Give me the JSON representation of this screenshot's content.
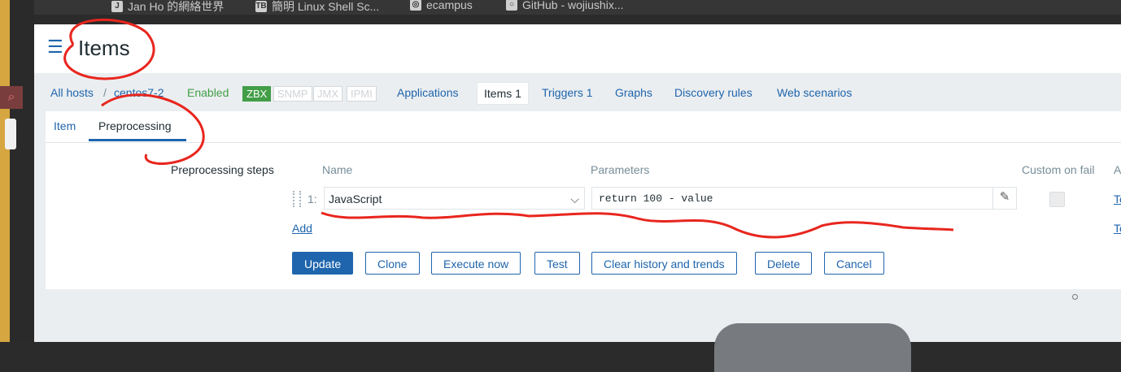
{
  "bookmarks": [
    {
      "icon": "J",
      "label": "Jan Ho 的網絡世界"
    },
    {
      "icon": "TB",
      "label": "簡明 Linux Shell Sc..."
    },
    {
      "icon": "◎",
      "label": "ecampus"
    },
    {
      "icon": "○",
      "label": "GitHub - wojiushix..."
    }
  ],
  "header": {
    "title": "Items"
  },
  "hostnav": {
    "all_hosts": "All hosts",
    "separator": "/",
    "host": "centos7-2",
    "status": "Enabled",
    "badges": [
      "ZBX",
      "SNMP",
      "JMX",
      "IPMI"
    ],
    "links": {
      "applications": "Applications",
      "items": "Items 1",
      "triggers": "Triggers 1",
      "graphs": "Graphs",
      "discovery": "Discovery rules",
      "web": "Web scenarios"
    }
  },
  "tabs": {
    "item": "Item",
    "preprocessing": "Preprocessing"
  },
  "form": {
    "section_label": "Preprocessing steps",
    "columns": {
      "name": "Name",
      "parameters": "Parameters",
      "custom": "Custom on fail",
      "actions": "A"
    },
    "step": {
      "index": "1:",
      "name": "JavaScript",
      "parameter": "return 100 - value",
      "action": "Te"
    },
    "add_label": "Add",
    "add_row_action": "Te"
  },
  "buttons": {
    "update": "Update",
    "clone": "Clone",
    "execute": "Execute now",
    "test": "Test",
    "clear": "Clear history and trends",
    "delete": "Delete",
    "cancel": "Cancel"
  },
  "colors": {
    "accent": "#1f65ad",
    "enabled": "#429e47",
    "annotation": "#e8261e"
  }
}
